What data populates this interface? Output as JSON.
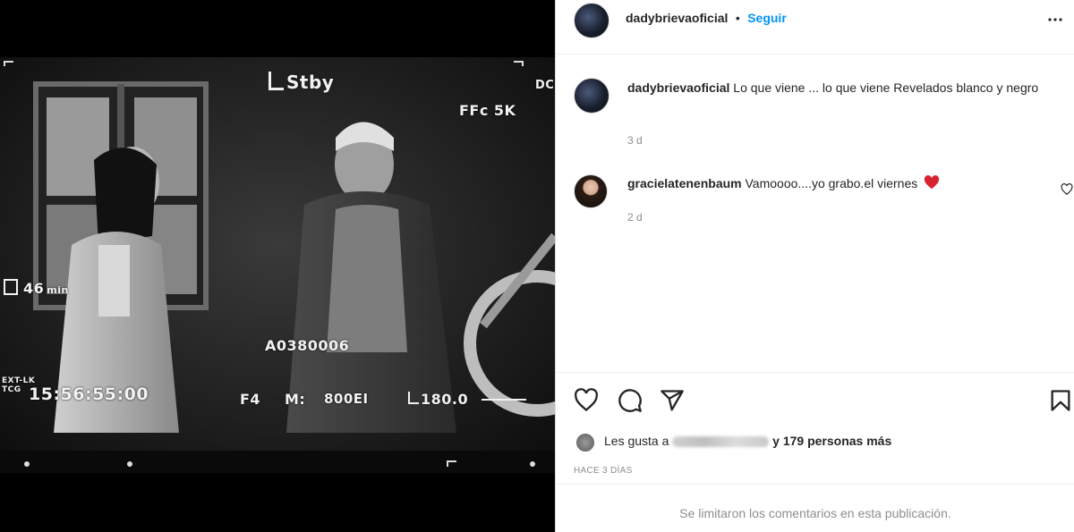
{
  "media": {
    "osd": {
      "stby": "Stby",
      "fps": "FFc 5K",
      "dc": "DC",
      "battery": "46",
      "battery_unit": "min",
      "clip": "A0380006",
      "timecode": "15:56:55:00",
      "tc_label_top": "EXT-LK",
      "tc_label": "TCG",
      "fstop": "F4",
      "iso_label": "M:",
      "iso": "800EI",
      "shutter": "180.0"
    }
  },
  "post": {
    "author": "dadybrievaoficial",
    "separator": "•",
    "follow_label": "Seguir",
    "caption_user": "dadybrievaoficial",
    "caption_text": "Lo que viene ... lo que viene Revelados blanco y negro",
    "caption_age": "3 d",
    "comments": [
      {
        "user": "gracielatenenbaum",
        "text": "Vamoooo....yo grabo.el viernes",
        "emoji": "❤️",
        "age": "2 d"
      }
    ],
    "likes_prefix": "Les gusta a",
    "likes_suffix": "y 179 personas más",
    "date": "HACE 3 DÍAS",
    "comments_limited": "Se limitaron los comentarios en esta publicación."
  },
  "colors": {
    "follow": "#0095f6",
    "heart": "#ed4956",
    "muted": "#8e8e8e"
  },
  "icons": [
    "more-icon",
    "heart-icon",
    "comment-icon",
    "share-icon",
    "bookmark-icon",
    "like-comment-icon"
  ]
}
